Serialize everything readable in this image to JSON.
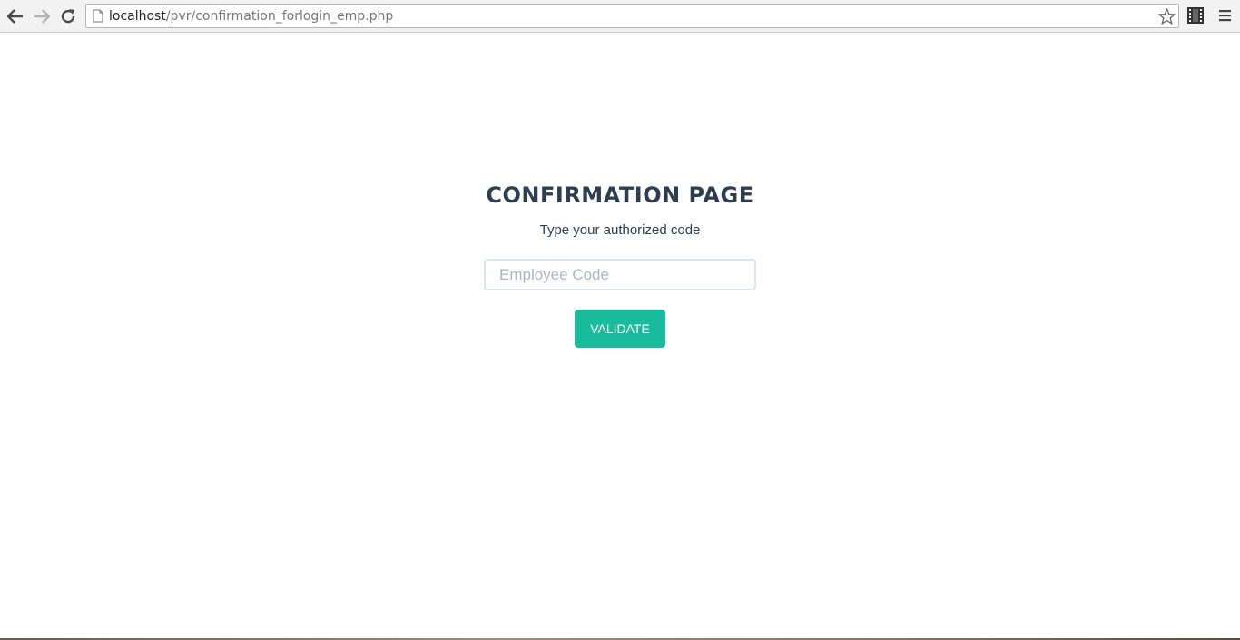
{
  "browser": {
    "url_host": "localhost",
    "url_path": "/pvr/confirmation_forlogin_emp.php",
    "icons": {
      "back": "back-arrow-icon",
      "forward": "forward-arrow-icon",
      "reload": "reload-icon",
      "page": "page-icon",
      "bookmark": "star-icon",
      "extension": "film-strip-icon",
      "menu": "hamburger-menu-icon"
    }
  },
  "page": {
    "title": "CONFIRMATION PAGE",
    "subtitle": "Type your authorized code",
    "code_input": {
      "placeholder": "Employee Code",
      "value": ""
    },
    "validate_label": "VALIDATE"
  },
  "colors": {
    "heading": "#2c3e50",
    "button": "#18bc9c",
    "input_border": "#dce4ec",
    "placeholder": "#acb6c0"
  }
}
